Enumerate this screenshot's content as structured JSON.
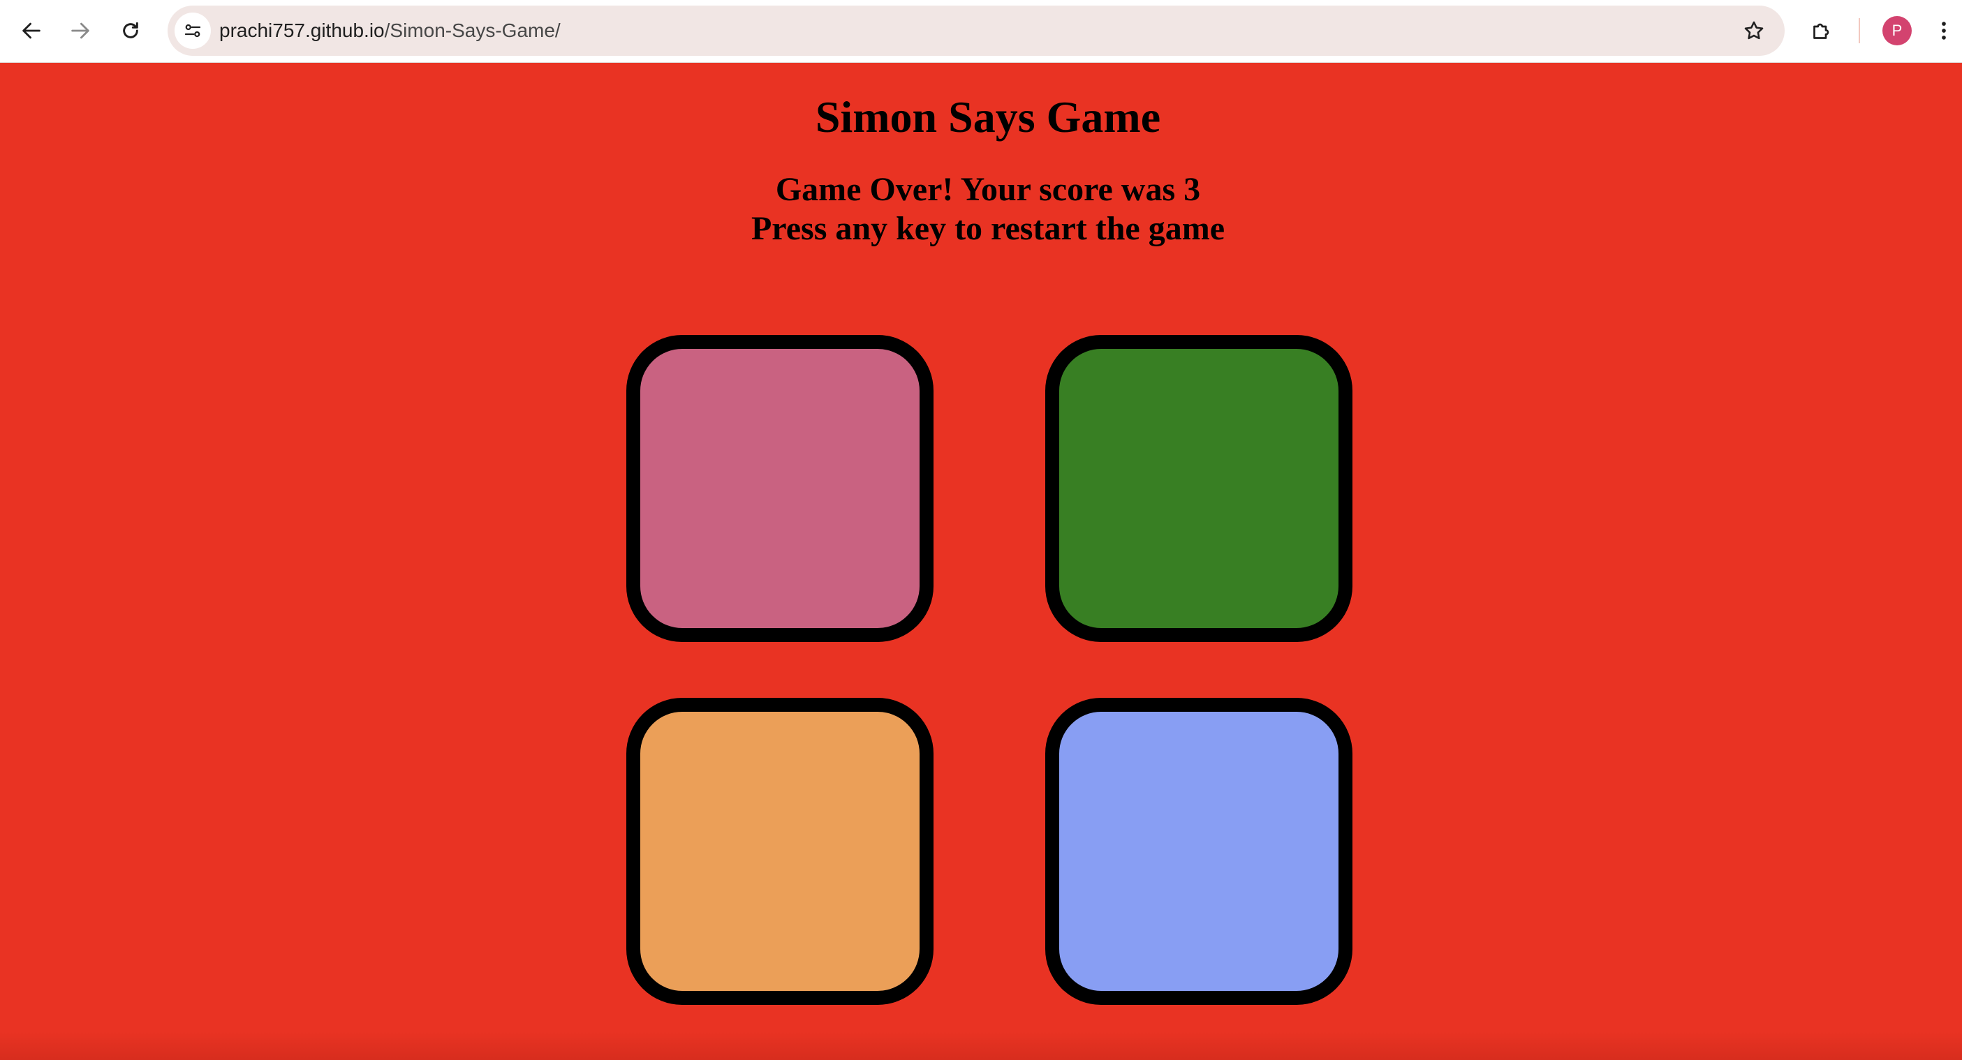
{
  "browser": {
    "url_host": "prachi757.github.io",
    "url_path": "/Simon-Says-Game/",
    "profile_initial": "P",
    "icons": {
      "back": "arrow-left-icon",
      "forward": "arrow-right-icon",
      "reload": "reload-icon",
      "site_info": "tune-icon",
      "bookmark": "star-icon",
      "extensions": "puzzle-icon",
      "menu": "kebab-menu-icon"
    }
  },
  "page": {
    "title": "Simon Says Game",
    "status_line_1": "Game Over! Your score was 3",
    "status_line_2": "Press any key to restart the game",
    "background_color": "#e93323"
  },
  "pads": [
    {
      "color_name": "pink",
      "color": "#c96281"
    },
    {
      "color_name": "green",
      "color": "#387f23"
    },
    {
      "color_name": "orange",
      "color": "#eb9f58"
    },
    {
      "color_name": "blue",
      "color": "#889ef3"
    }
  ]
}
